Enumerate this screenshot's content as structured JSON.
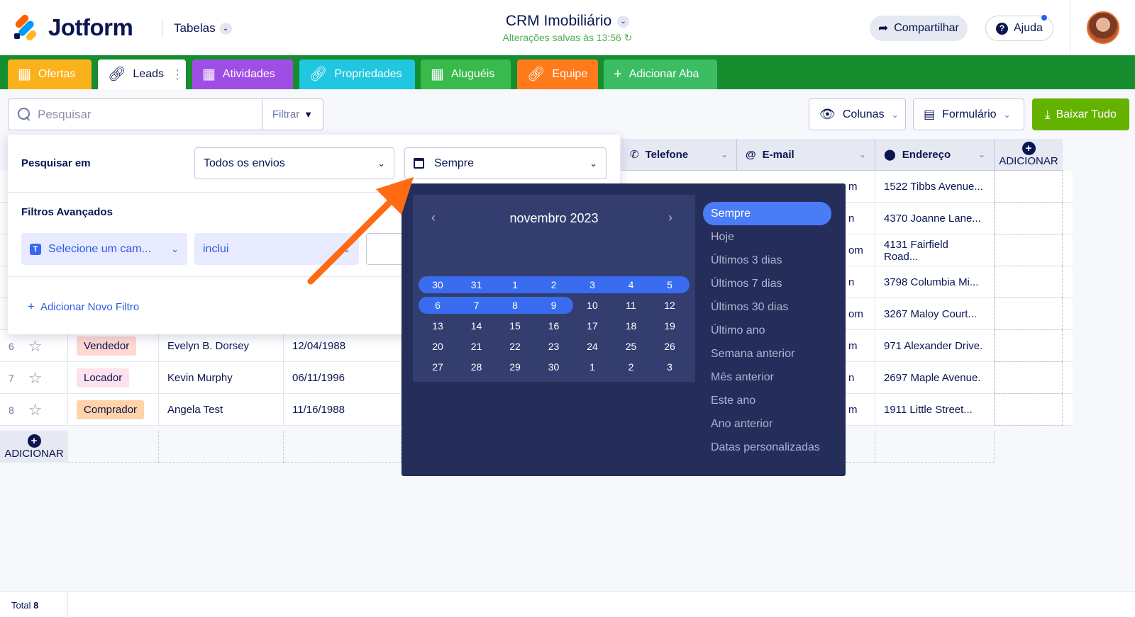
{
  "header": {
    "logo_text": "Jotform",
    "tables_label": "Tabelas",
    "title": "CRM Imobiliário",
    "saved_status": "Alterações salvas às 13:56 ",
    "share_label": "Compartilhar",
    "help_label": "Ajuda"
  },
  "tabs": [
    {
      "label": "Ofertas",
      "icon": "grid-icon",
      "color": "#fbb21a"
    },
    {
      "label": "Leads",
      "icon": "link-icon",
      "color": "#ffffff"
    },
    {
      "label": "Atividades",
      "icon": "grid-icon",
      "color": "#9f4ee5"
    },
    {
      "label": "Propriedades",
      "icon": "link-icon",
      "color": "#1fc7e0"
    },
    {
      "label": "Aluguéis",
      "icon": "grid-icon",
      "color": "#38ba4c"
    },
    {
      "label": "Equipe",
      "icon": "link-icon",
      "color": "#ff7a1a"
    },
    {
      "label": "Adicionar Aba",
      "icon": "plus-icon",
      "color": "#3cbd64"
    }
  ],
  "toolbar": {
    "search_placeholder": "Pesquisar",
    "filter_label": "Filtrar",
    "columns_label": "Colunas",
    "form_label": "Formulário",
    "download_label": "Baixar Tudo"
  },
  "table": {
    "headers_visible": [
      {
        "label": "Telefone",
        "icon": "phone-icon"
      },
      {
        "label": "E-mail",
        "icon": "at-icon"
      },
      {
        "label": "Endereço",
        "icon": "pin-icon"
      }
    ],
    "add_column_label": "ADICIONAR",
    "add_row_label": "ADICIONAR",
    "rows": [
      {
        "num": "",
        "type": "",
        "name": "",
        "date": "",
        "email": "m",
        "address": "1522 Tibbs Avenue..."
      },
      {
        "num": "",
        "type": "",
        "name": "",
        "date": "",
        "email": "n",
        "address": "4370 Joanne Lane..."
      },
      {
        "num": "",
        "type": "",
        "name": "",
        "date": "",
        "email": "om",
        "address": "4131 Fairfield Road..."
      },
      {
        "num": "",
        "type": "",
        "name": "",
        "date": "",
        "email": "n",
        "address": "3798 Columbia Mi..."
      },
      {
        "num": "",
        "type": "",
        "name": "",
        "date": "",
        "email": "om",
        "address": "3267 Maloy Court..."
      },
      {
        "num": "6",
        "type": "Vendedor",
        "type_color": "#ffd8d2",
        "name": "Evelyn B. Dorsey",
        "date": "12/04/1988",
        "email": "m",
        "address": "971 Alexander Drive."
      },
      {
        "num": "7",
        "type": "Locador",
        "type_color": "#fde1ef",
        "name": "Kevin Murphy",
        "date": "06/11/1996",
        "email": "n",
        "address": "2697 Maple Avenue."
      },
      {
        "num": "8",
        "type": "Comprador",
        "type_color": "#ffd3a8",
        "name": "Angela Test",
        "date": "11/16/1988",
        "email": "m",
        "address": "1911 Little Street..."
      }
    ]
  },
  "filter_panel": {
    "search_in_label": "Pesquisar em",
    "submissions_select": "Todos os envios",
    "date_select": "Sempre",
    "advanced_label": "Filtros Avançados",
    "field_select": "Selecione um cam...",
    "operator_select": "inclui",
    "add_filter_label": "Adicionar Novo Filtro"
  },
  "calendar": {
    "month_label": "novembro 2023",
    "weeks": [
      [
        "30",
        "31",
        "1",
        "2",
        "3",
        "4",
        "5"
      ],
      [
        "6",
        "7",
        "8",
        "9",
        "10",
        "11",
        "12"
      ],
      [
        "13",
        "14",
        "15",
        "16",
        "17",
        "18",
        "19"
      ],
      [
        "20",
        "21",
        "22",
        "23",
        "24",
        "25",
        "26"
      ],
      [
        "27",
        "28",
        "29",
        "30",
        "1",
        "2",
        "3"
      ]
    ],
    "highlight_count": 11,
    "ranges": [
      "Sempre",
      "Hoje",
      "Últimos 3 dias",
      "Últimos 7 dias",
      "Últimos 30 dias",
      "Último ano",
      "Semana anterior",
      "Mês anterior",
      "Este ano",
      "Ano anterior",
      "Datas personalizadas"
    ],
    "active_range": "Sempre"
  },
  "footer": {
    "total_label": "Total",
    "total_value": "8"
  },
  "colors": {
    "tabs_bar": "#168e2f",
    "accent_blue": "#3a6cf0",
    "download_green": "#64b200",
    "calendar_bg": "#252d5b",
    "arrow": "#ff6a13"
  }
}
